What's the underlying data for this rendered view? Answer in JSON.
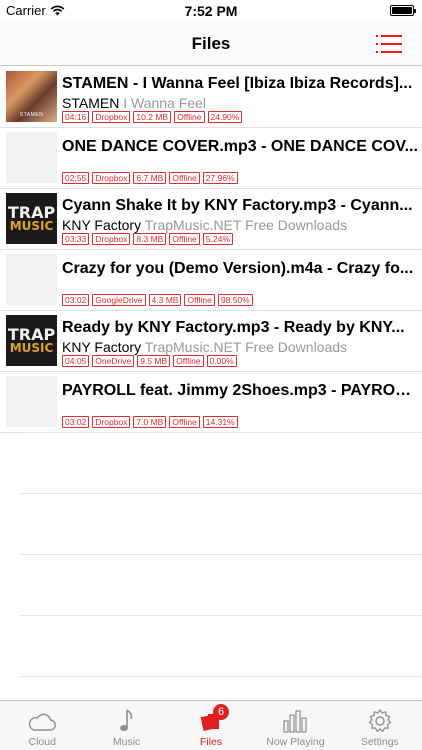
{
  "status_bar": {
    "carrier": "Carrier",
    "time": "7:52 PM"
  },
  "nav": {
    "title": "Files"
  },
  "files": [
    {
      "title": "STAMEN - I Wanna Feel [Ibiza Ibiza Records]...",
      "artist": "STAMEN",
      "album": "I Wanna Feel",
      "duration": "04:16",
      "source": "Dropbox",
      "size": "10.2 MB",
      "status": "Offline",
      "progress": "24.90%",
      "thumb": "art",
      "thumb_label": "STAMEN"
    },
    {
      "title": "ONE DANCE COVER.mp3 - ONE DANCE COV...",
      "artist": "",
      "album": "",
      "duration": "02:55",
      "source": "Dropbox",
      "size": "6.7 MB",
      "status": "Offline",
      "progress": "27.96%",
      "thumb": "blank"
    },
    {
      "title": "Cyann Shake It by KNY Factory.mp3 - Cyann...",
      "artist": "KNY Factory",
      "album": "TrapMusic.NET Free Downloads",
      "duration": "03:33",
      "source": "Dropbox",
      "size": "8.3 MB",
      "status": "Offline",
      "progress": "5.24%",
      "thumb": "trap",
      "thumb_line1": "TRAP",
      "thumb_line2": "MUSIC"
    },
    {
      "title": "Crazy for you (Demo Version).m4a - Crazy fo...",
      "artist": "",
      "album": "",
      "duration": "03:02",
      "source": "GoogleDrive",
      "size": "4.3 MB",
      "status": "Offline",
      "progress": "98.50%",
      "thumb": "blank"
    },
    {
      "title": "Ready by KNY Factory.mp3 - Ready by KNY...",
      "artist": "KNY Factory",
      "album": "TrapMusic.NET Free Downloads",
      "duration": "04:05",
      "source": "OneDrive",
      "size": "9.5 MB",
      "status": "Offline",
      "progress": "0.00%",
      "thumb": "trap",
      "thumb_line1": "TRAP",
      "thumb_line2": "MUSIC"
    },
    {
      "title": "PAYROLL feat. Jimmy 2Shoes.mp3 - PAYROL...",
      "artist": "",
      "album": "",
      "duration": "03:02",
      "source": "Dropbox",
      "size": "7.0 MB",
      "status": "Offline",
      "progress": "14.31%",
      "thumb": "blank"
    }
  ],
  "tabs": [
    {
      "label": "Cloud",
      "icon": "cloud-icon"
    },
    {
      "label": "Music",
      "icon": "music-note-icon"
    },
    {
      "label": "Files",
      "icon": "files-icon",
      "badge": "6",
      "active": true
    },
    {
      "label": "Now Playing",
      "icon": "equalizer-icon"
    },
    {
      "label": "Settings",
      "icon": "gear-icon"
    }
  ],
  "colors": {
    "accent": "#e02020",
    "muted": "#8e8e93",
    "album_text": "#999999"
  }
}
